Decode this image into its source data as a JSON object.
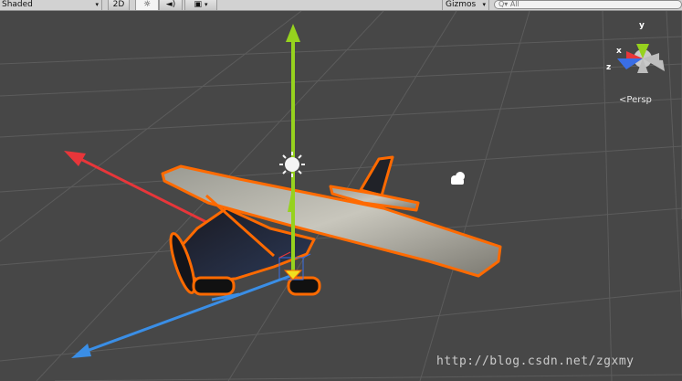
{
  "toolbar": {
    "shading_mode": "Shaded",
    "mode_2d": "2D",
    "gizmos_label": "Gizmos",
    "search_placeholder": "All"
  },
  "scene": {
    "gizmo_axis_y": "y",
    "gizmo_axis_x": "x",
    "gizmo_axis_z": "z",
    "projection_label": "Persp",
    "watermark": "http://blog.csdn.net/zgxmy"
  },
  "colors": {
    "background": "#474747",
    "selection_outline": "#ff6a00",
    "axis_x": "#e8363a",
    "axis_y": "#96d21e",
    "axis_z": "#3a8ee6"
  },
  "icons": [
    "sun-icon",
    "speaker-icon",
    "image-icon",
    "search-icon",
    "scene-light-icon",
    "audio-source-icon"
  ]
}
